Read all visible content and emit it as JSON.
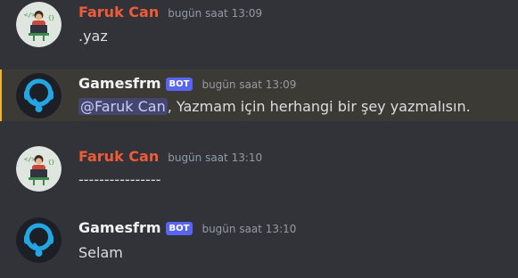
{
  "colors": {
    "background": "#313338",
    "highlight_bg": "#3c3a34",
    "highlight_border": "#f0b232",
    "user_name": "#f05b3a",
    "bot_name": "#f2f3f5",
    "bot_badge": "#5865f2",
    "timestamp": "#949ba4",
    "message_text": "#dbdee1",
    "mention_bg": "#4a4f82",
    "mention_text": "#c9cdfb"
  },
  "messages": [
    {
      "author": "Faruk Can",
      "avatar_icon": "coder-desk-avatar-icon",
      "timestamp": "bugün saat 13:09",
      "text": ".yaz"
    },
    {
      "author": "Gamesfrm",
      "badge": "BOT",
      "avatar_icon": "gamesfrm-headset-logo-icon",
      "timestamp": "bugün saat 13:09",
      "mention": "@Faruk Can",
      "text": ", Yazmam için herhangi bir şey yazmalısın."
    },
    {
      "author": "Faruk Can",
      "avatar_icon": "coder-desk-avatar-icon",
      "timestamp": "bugün saat 13:10",
      "text": "----------------"
    },
    {
      "author": "Gamesfrm",
      "badge": "BOT",
      "avatar_icon": "gamesfrm-headset-logo-icon",
      "timestamp": "bugün saat 13:10",
      "text": "Selam"
    }
  ]
}
